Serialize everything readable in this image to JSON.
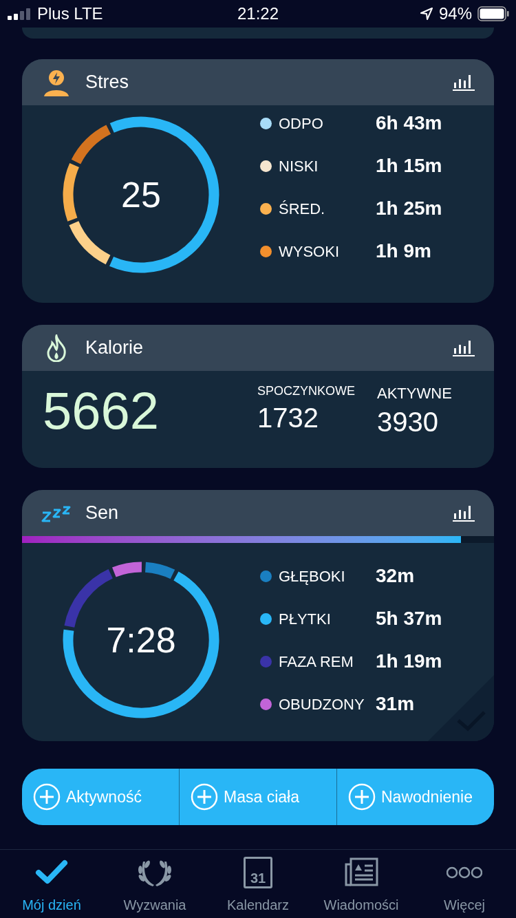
{
  "status_bar": {
    "carrier": "Plus LTE",
    "time": "21:22",
    "battery": "94%"
  },
  "stress": {
    "title": "Stres",
    "score": "25",
    "legend": [
      {
        "label": "ODPO",
        "value": "6h 43m",
        "color": "#a8dcf8"
      },
      {
        "label": "NISKI",
        "value": "1h 15m",
        "color": "#f6e6cf"
      },
      {
        "label": "ŚRED.",
        "value": "1h 25m",
        "color": "#fbb14f"
      },
      {
        "label": "WYSOKI",
        "value": "1h 9m",
        "color": "#f28f2d"
      }
    ]
  },
  "calories": {
    "title": "Kalorie",
    "total": "5662",
    "stats": [
      {
        "label": "SPOCZYNKOWE",
        "value": "1732"
      },
      {
        "label": "AKTYWNE",
        "value": "3930"
      }
    ]
  },
  "sleep": {
    "title": "Sen",
    "progress": {
      "level": 0.93
    },
    "duration": "7:28",
    "legend": [
      {
        "label": "GŁĘBOKI",
        "value": "32m",
        "color": "#1a7fc1"
      },
      {
        "label": "PŁYTKI",
        "value": "5h 37m",
        "color": "#29b6f6"
      },
      {
        "label": "FAZA REM",
        "value": "1h 19m",
        "color": "#3a33a8"
      },
      {
        "label": "OBUDZONY",
        "value": "31m",
        "color": "#c264d8"
      }
    ]
  },
  "quick_add": [
    "Aktywność",
    "Masa ciała",
    "Nawodnienie"
  ],
  "tabs": [
    {
      "label": "Mój dzień",
      "kind": "check",
      "selected": true
    },
    {
      "label": "Wyzwania",
      "kind": "laurel",
      "selected": false
    },
    {
      "label": "Kalendarz",
      "kind": "calendar",
      "selected": false,
      "badge": "31"
    },
    {
      "label": "Wiadomości",
      "kind": "news",
      "selected": false
    },
    {
      "label": "Więcej",
      "kind": "more",
      "selected": false
    }
  ]
}
